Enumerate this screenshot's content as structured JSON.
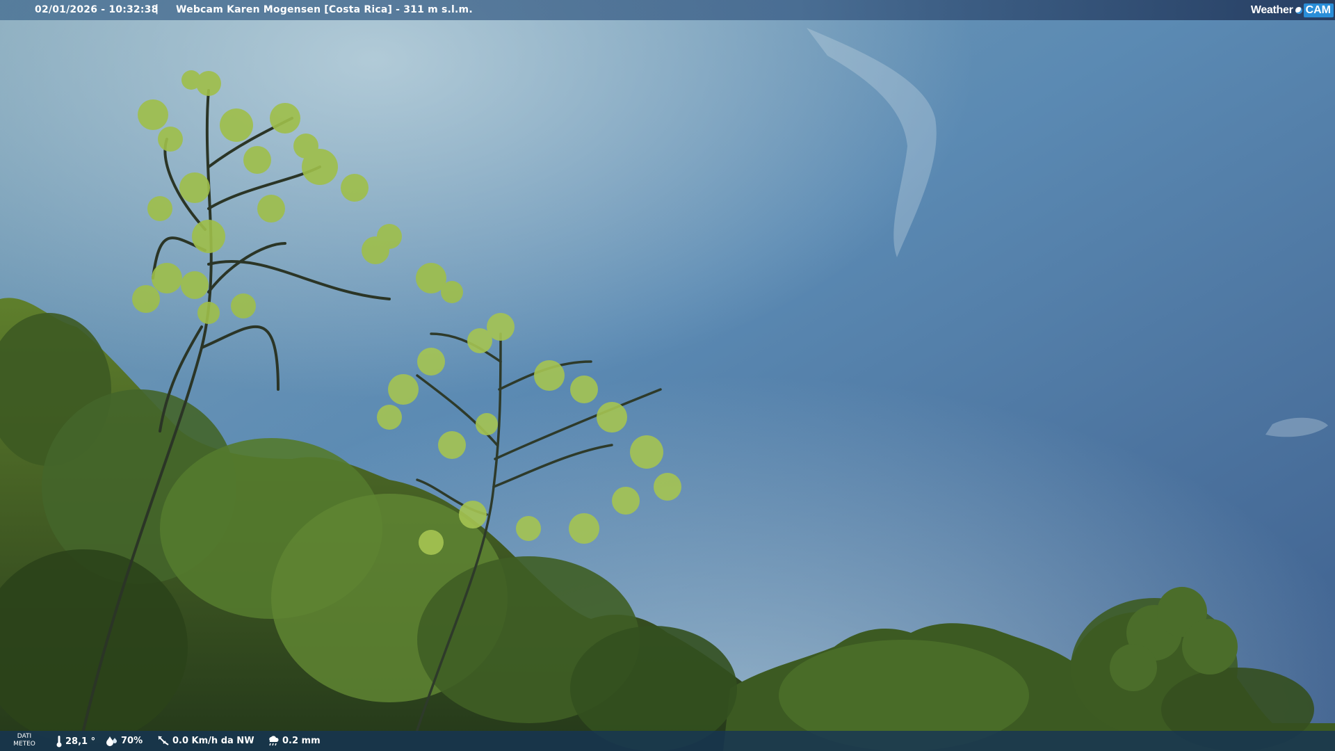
{
  "header": {
    "datetime": "02/01/2026 - 10:32:38",
    "separator": "|",
    "title": "Webcam Karen Mogensen [Costa Rica] - 311 m s.l.m.",
    "logo_left": "Weather",
    "logo_right": "CAM"
  },
  "footer": {
    "label_line1": "DATI",
    "label_line2": "METEO",
    "temperature": "28,1 °",
    "humidity": "70%",
    "wind": "0.0 Km/h da NW",
    "rain": "0.2 mm"
  },
  "icons": {
    "temperature": "thermometer-icon",
    "humidity": "droplet-icon",
    "wind": "wind-vane-icon",
    "rain": "rain-cloud-icon",
    "logo": "weathercam-logo"
  },
  "colors": {
    "sky_top": "#6d94ae",
    "sky_bottom": "#7ea4bf",
    "foliage_dark": "#2f4a1e",
    "foliage_light": "#9fbf4a",
    "bar_bg": "#163454",
    "logo_accent": "#2a8ed8"
  }
}
